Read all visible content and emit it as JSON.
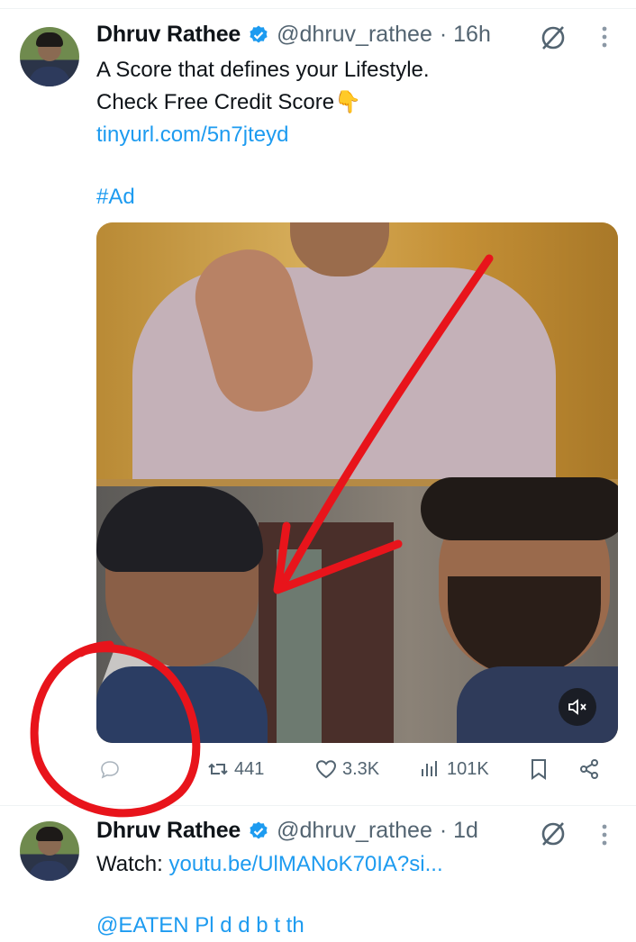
{
  "tweets": [
    {
      "author_name": "Dhruv Rathee",
      "handle": "@dhruv_rathee",
      "time": "· 16h",
      "line1": "A Score that defines your Lifestyle.",
      "line2": "Check Free Credit Score👇",
      "link": "tinyurl.com/5n7jteyd",
      "hashtag": "#Ad",
      "actions": {
        "reply": "",
        "retweets": "441",
        "likes": "3.3K",
        "views": "101K"
      }
    },
    {
      "author_name": "Dhruv Rathee",
      "handle": "@dhruv_rathee",
      "time": "· 1d",
      "prefix": "Watch: ",
      "link": "youtu.be/UlMANoK70IA?si...",
      "next_line": "@EATEN        Pl    d        d      b    t th"
    }
  ],
  "colors": {
    "link": "#1d9bf0",
    "muted": "#536471",
    "verified": "#1d9bf0",
    "annotation": "#e8141b"
  },
  "icons": [
    "verified-badge-icon",
    "mute-notifications-icon",
    "more-options-icon",
    "mute-volume-icon",
    "reply-icon",
    "retweet-icon",
    "like-icon",
    "views-icon",
    "bookmark-icon",
    "share-icon"
  ]
}
